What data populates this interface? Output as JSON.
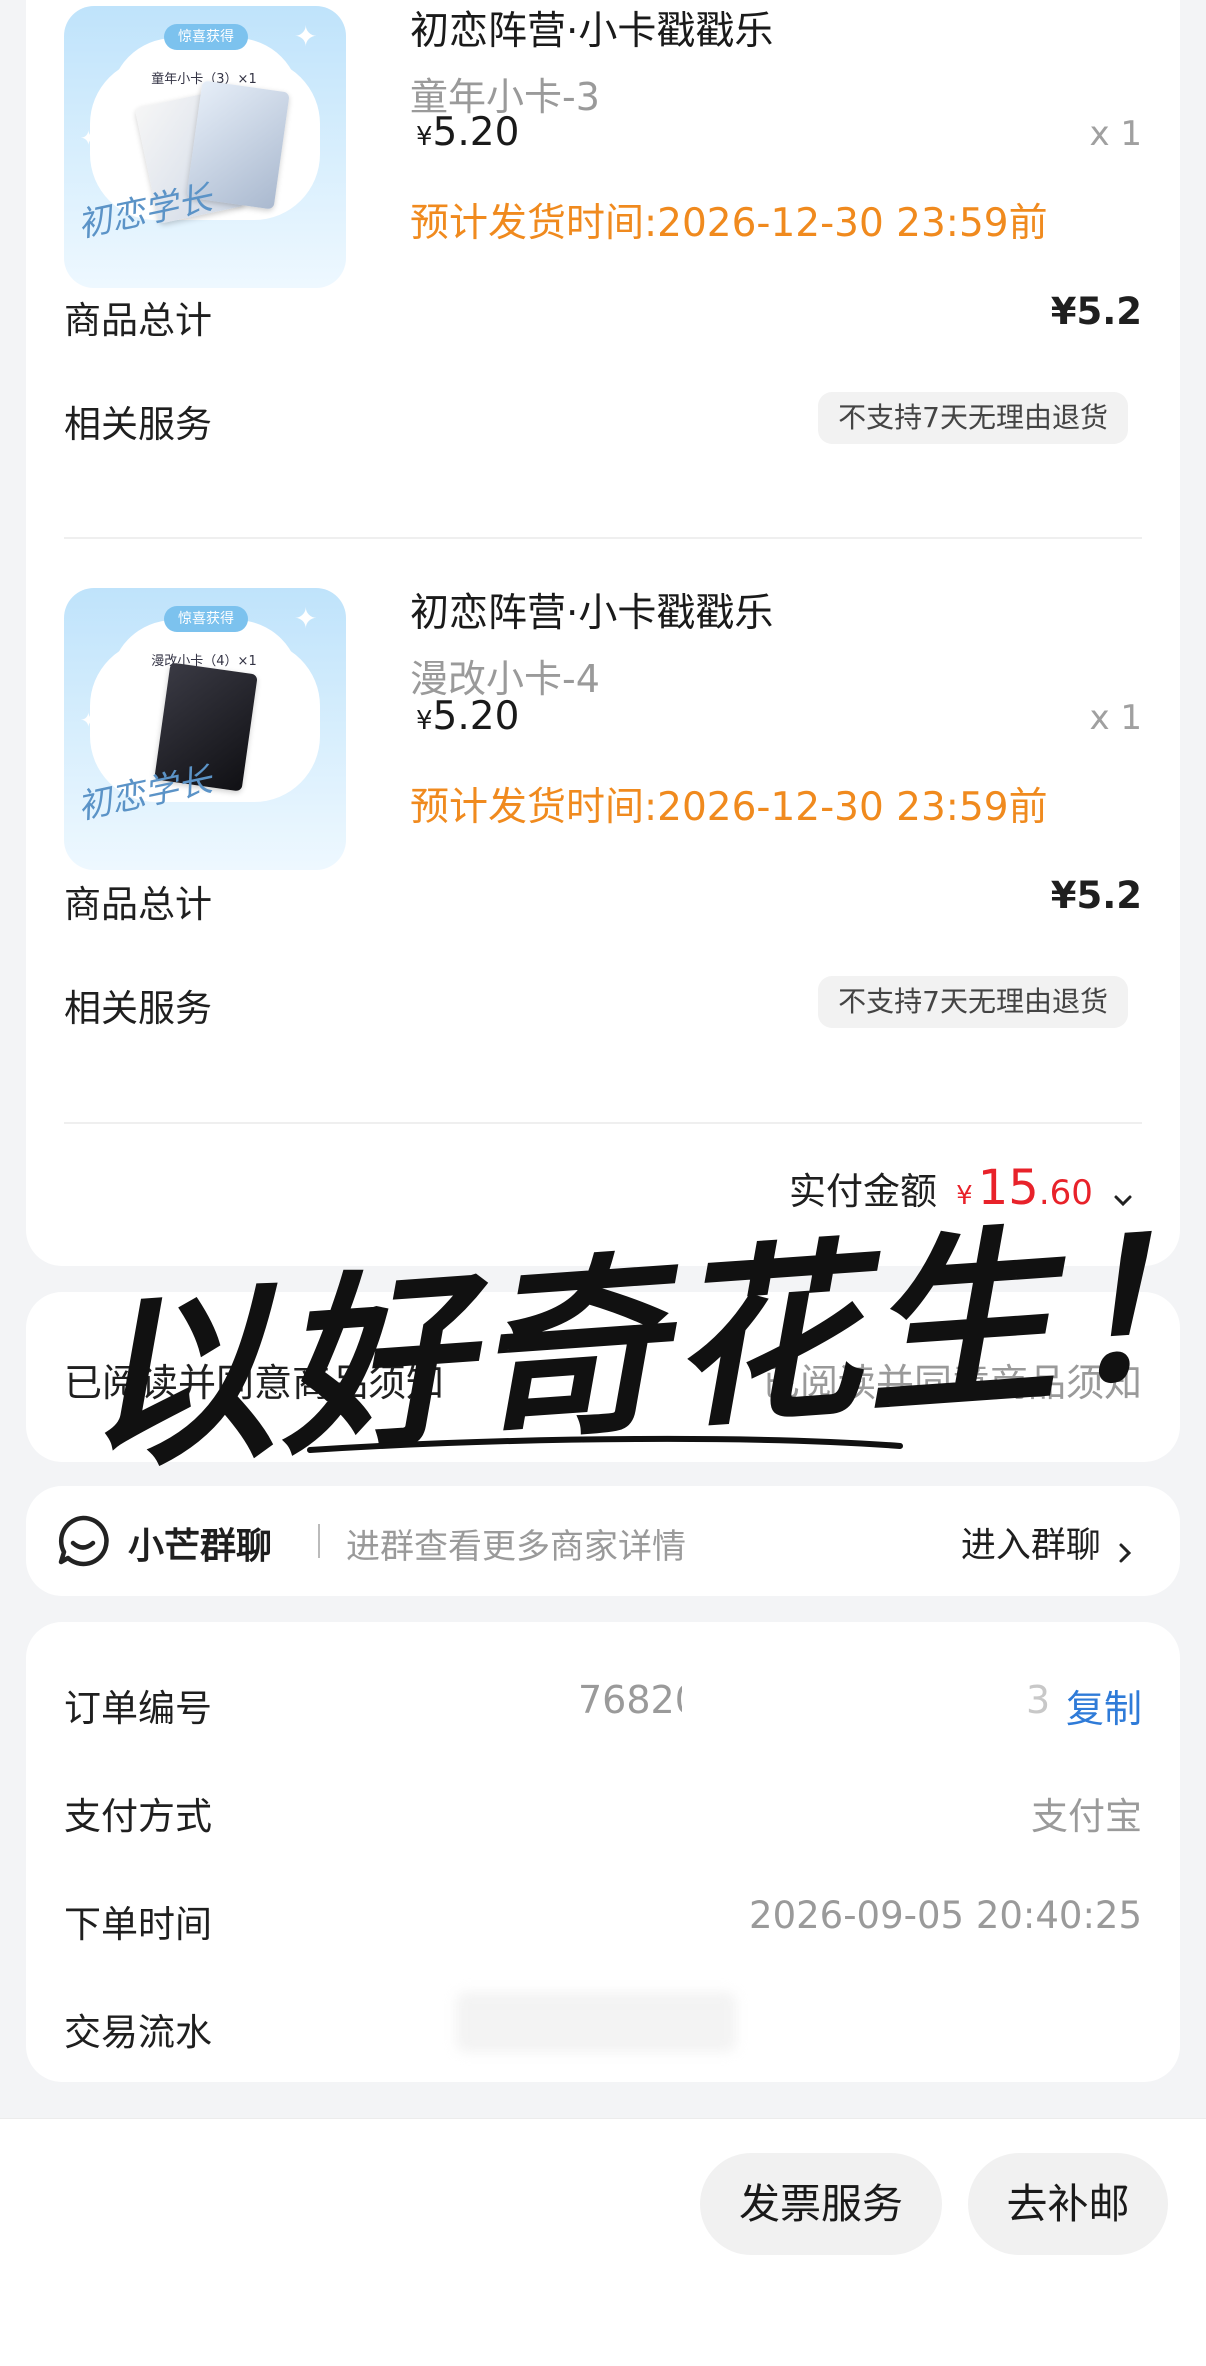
{
  "products": [
    {
      "title": "初恋阵营·小卡戳戳乐",
      "variant": "童年小卡-3",
      "currency": "¥",
      "price": "5.20",
      "qty": "x 1",
      "ship": "预计发货时间:2026-12-30 23:59前",
      "thumb_tag": "惊喜获得",
      "thumb_title": "童年小卡（3）×1",
      "subtotal_label": "商品总计",
      "subtotal": "¥5.2",
      "service_label": "相关服务",
      "service": "不支持7天无理由退货"
    },
    {
      "title": "初恋阵营·小卡戳戳乐",
      "variant": "漫改小卡-4",
      "currency": "¥",
      "price": "5.20",
      "qty": "x 1",
      "ship": "预计发货时间:2026-12-30 23:59前",
      "thumb_tag": "惊喜获得",
      "thumb_title": "漫改小卡（4）×1",
      "subtotal_label": "商品总计",
      "subtotal": "¥5.2",
      "service_label": "相关服务",
      "service": "不支持7天无理由退货"
    }
  ],
  "total": {
    "label": "实付金额",
    "currency": "¥",
    "integer": "15",
    "decimal": ".60"
  },
  "agreement": {
    "left": "已阅读并同意商品须知",
    "right": "已阅读并同意商品须知",
    "overlay": "以好奇花生！"
  },
  "group_chat": {
    "name": "小芒群聊",
    "desc": "进群查看更多商家详情",
    "action": "进入群聊"
  },
  "order_info": {
    "order_no_label": "订单编号",
    "order_no": "76820",
    "order_no_tail": "3",
    "copy": "复制",
    "pay_label": "支付方式",
    "pay": "支付宝",
    "time_label": "下单时间",
    "time": "2026-09-05 20:40:25",
    "flow_label": "交易流水"
  },
  "actions": {
    "invoice": "发票服务",
    "repost": "去补邮"
  },
  "colors": {
    "accent_orange": "#f08a1e",
    "price_red": "#e8222a",
    "link_blue": "#2f7bd8"
  }
}
